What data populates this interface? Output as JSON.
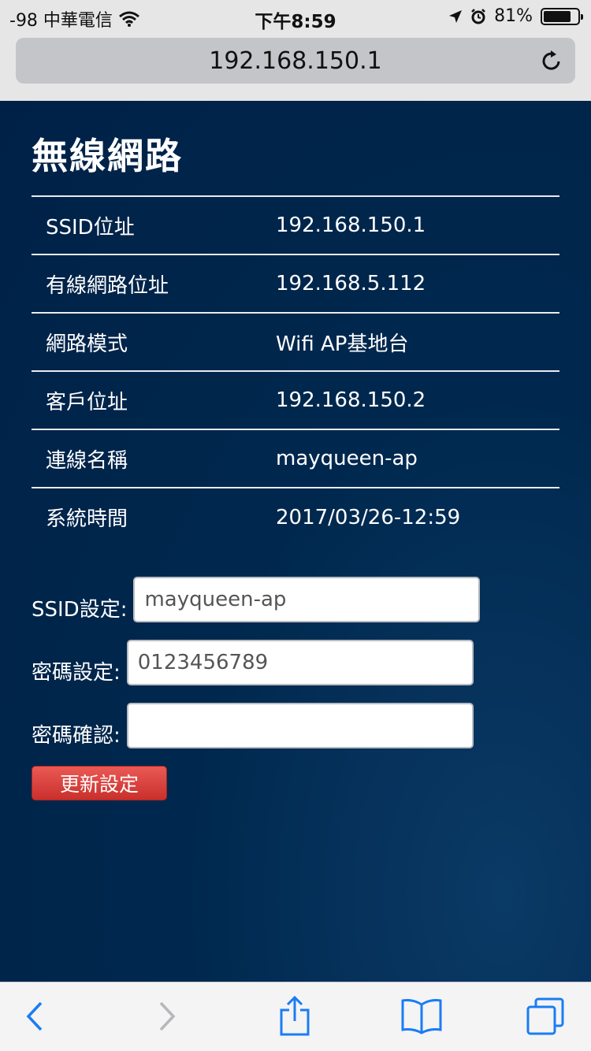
{
  "status_bar": {
    "carrier": "-98 中華電信",
    "time": "下午8:59",
    "battery_percent": "81%",
    "battery_level": 0.81
  },
  "browser": {
    "url": "192.168.150.1"
  },
  "page": {
    "title": "無線網路",
    "info_rows": [
      {
        "label": "SSID位址",
        "value": "192.168.150.1"
      },
      {
        "label": "有線網路位址",
        "value": "192.168.5.112"
      },
      {
        "label": "網路模式",
        "value": "Wifi AP基地台"
      },
      {
        "label": "客戶位址",
        "value": "192.168.150.2"
      },
      {
        "label": "連線名稱",
        "value": "mayqueen-ap"
      },
      {
        "label": "系統時間",
        "value": "2017/03/26-12:59"
      }
    ],
    "form": {
      "ssid_label": "SSID設定:",
      "ssid_value": "mayqueen-ap",
      "password_label": "密碼設定:",
      "password_value": "0123456789",
      "confirm_label": "密碼確認:",
      "confirm_value": "",
      "submit_label": "更新設定"
    }
  },
  "toolbar": {
    "icons": [
      "back-icon",
      "forward-icon",
      "share-icon",
      "bookmarks-icon",
      "tabs-icon"
    ],
    "accent_color": "#1a7cf5",
    "disabled_color": "#b6b6bb"
  },
  "colors": {
    "page_background": "#002a52",
    "button_red": "#d9433e"
  }
}
